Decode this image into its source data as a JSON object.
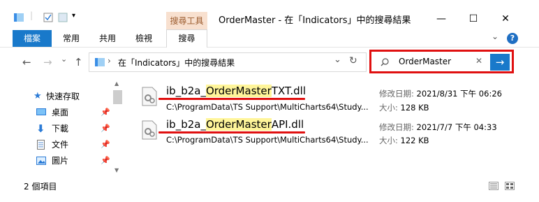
{
  "window": {
    "title": "OrderMaster - 在「Indicators」中的搜尋結果",
    "context_tab_group": "搜尋工具",
    "controls": {
      "minimize": "—",
      "maximize": "☐",
      "close": "✕"
    }
  },
  "ribbon": {
    "tabs": [
      {
        "label": "檔案",
        "active": false,
        "style": "file"
      },
      {
        "label": "常用"
      },
      {
        "label": "共用"
      },
      {
        "label": "檢視"
      },
      {
        "label": "搜尋",
        "active": true
      }
    ],
    "help": "?"
  },
  "address": {
    "back": "←",
    "forward": "→",
    "recent": "⌄",
    "up": "↑",
    "path_separator": "›",
    "path": "在「Indicators」中的搜尋結果",
    "dropdown": "⌄",
    "refresh": "↻"
  },
  "search": {
    "query": "OrderMaster",
    "clear": "✕",
    "go": "→"
  },
  "nav_pane": {
    "items": [
      {
        "label": "快速存取",
        "icon": "star-icon"
      },
      {
        "label": "桌面",
        "icon": "desktop-icon",
        "pinned": true
      },
      {
        "label": "下載",
        "icon": "download-icon",
        "pinned": true
      },
      {
        "label": "文件",
        "icon": "document-icon",
        "pinned": true
      },
      {
        "label": "圖片",
        "icon": "pictures-icon",
        "pinned": true
      }
    ]
  },
  "results": [
    {
      "name_prefix": "ib_b2a_",
      "name_match": "OrderMaster",
      "name_suffix": "TXT.dll",
      "path": "C:\\ProgramData\\TS Support\\MultiCharts64\\Study...",
      "modified_label": "修改日期:",
      "modified_value": "2021/8/31 下午 06:26",
      "size_label": "大小:",
      "size_value": "128 KB"
    },
    {
      "name_prefix": "ib_b2a_",
      "name_match": "OrderMaster",
      "name_suffix": "API.dll",
      "path": "C:\\ProgramData\\TS Support\\MultiCharts64\\Study...",
      "modified_label": "修改日期:",
      "modified_value": "2021/7/7 下午 04:33",
      "size_label": "大小:",
      "size_value": "122 KB"
    }
  ],
  "status": {
    "item_count": "2 個項目"
  },
  "colors": {
    "accent": "#1979ca",
    "highlight": "#fff59a",
    "annotation_red": "#e01010",
    "context_tab": "#f8e0cf"
  }
}
